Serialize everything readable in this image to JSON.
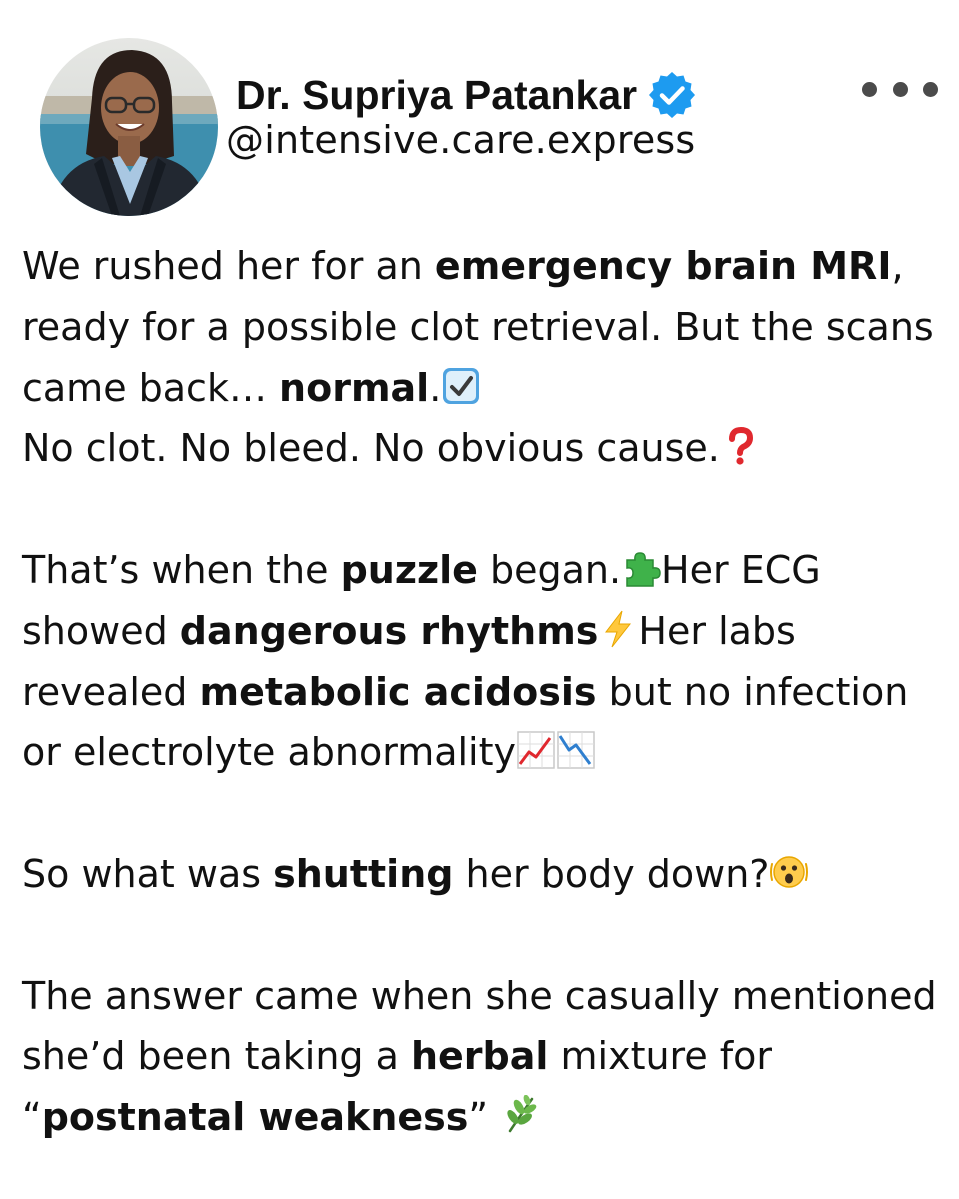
{
  "author": {
    "name": "Dr. Supriya Patankar",
    "handle": "@intensive.care.express",
    "verified_color": "#1D9BF0"
  },
  "post": {
    "p1": {
      "t1": "We rushed her for an ",
      "b1": "emergency brain MRI",
      "t2": ", ready for a possible clot retrieval. But the scans came back… ",
      "b2": "normal",
      "t3": ".",
      "e1": "check-mark-button-emoji",
      "line2": "No clot. No bleed. No obvious cause.",
      "e2": "red-question-mark-emoji"
    },
    "p2": {
      "t1": "That’s when the ",
      "b1": "puzzle",
      "t2": " began.",
      "e1": "puzzle-piece-emoji",
      "t3": "Her ECG showed ",
      "b2": "dangerous rhythms",
      "e2": "high-voltage-emoji",
      "t4": "Her labs revealed ",
      "b3": "metabolic acidosis",
      "t5": " but no infection or electrolyte abnormality",
      "e3": "chart-increasing-emoji",
      "e4": "chart-decreasing-emoji"
    },
    "p3": {
      "t1": "So what was ",
      "b1": "shutting",
      "t2": " her body down?",
      "e1": "shaking-face-emoji"
    },
    "p4": {
      "t1": "The answer came when she casually mentioned she’d been taking a ",
      "b1": "herbal",
      "t2": " mixture for “",
      "b2": "postnatal weakness",
      "t3": "” ",
      "e1": "herb-emoji"
    }
  },
  "icons": {
    "more": "more-horizontal-icon",
    "verified": "verified-badge-icon"
  }
}
